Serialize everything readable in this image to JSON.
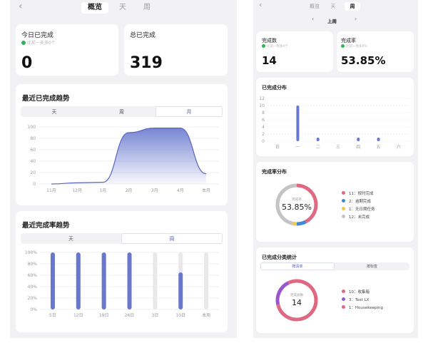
{
  "colors": {
    "accent": "#6878cf",
    "light_bar": "#e9e9ec",
    "pink": "#dd6a82",
    "blue": "#3f8bd6",
    "yellow": "#f2c94c",
    "gray": "#c4c4c4",
    "purple": "#9a56d1",
    "green": "#2fb45a"
  },
  "left": {
    "tabs": [
      "概览",
      "天",
      "周"
    ],
    "today": {
      "label": "今日已完成",
      "sub": "比前一天多0个",
      "value": "0"
    },
    "total": {
      "label": "总已完成",
      "value": "319"
    },
    "trend": {
      "title": "最近已完成趋势",
      "toggle": [
        "天",
        "周",
        "月"
      ]
    },
    "rate": {
      "title": "最近完成率趋势",
      "toggle": [
        "天",
        "周"
      ]
    }
  },
  "right": {
    "tabs": [
      "概览",
      "天",
      "周"
    ],
    "period": "上周",
    "done": {
      "label": "完成数",
      "sub": "比前一周多0个",
      "value": "14"
    },
    "rate": {
      "label": "完成率",
      "sub": "比前一周多0%",
      "value": "53.85%"
    },
    "dist": {
      "title": "已完成分布"
    },
    "rate_dist": {
      "title": "完成率分布",
      "center_label": "完成率",
      "center_value": "53.85%",
      "legend": [
        "11：按时完成",
        "2：逾期完成",
        "1：无日期任务",
        "12：未完成"
      ]
    },
    "cat": {
      "title": "已完成分类统计",
      "toggle": [
        "按清单",
        "按标签"
      ],
      "center_label": "完成总数",
      "center_value": "14",
      "legend": [
        "10：收集箱",
        "3：Test LX",
        "1：Housekeeping"
      ]
    }
  },
  "chart_data": [
    {
      "type": "area",
      "categories": [
        "11月",
        "12月",
        "1月",
        "2月",
        "3月",
        "4月",
        "本月"
      ],
      "values": [
        0,
        2,
        3,
        90,
        98,
        98,
        18
      ],
      "yticks": [
        "100",
        "80",
        "60",
        "40",
        "20",
        "0"
      ],
      "ylim": [
        0,
        100
      ]
    },
    {
      "type": "bar",
      "categories": [
        "5日",
        "12日",
        "19日",
        "26日",
        "3日",
        "10日",
        "本周"
      ],
      "values": [
        100,
        100,
        100,
        100,
        0,
        65,
        0
      ],
      "yticks": [
        "100%",
        "80%",
        "60%",
        "40%",
        "20%",
        "0%"
      ],
      "ylim": [
        0,
        100
      ]
    },
    {
      "type": "bar",
      "categories": [
        "日",
        "一",
        "二",
        "三",
        "四",
        "五",
        "六"
      ],
      "values": [
        0,
        10,
        1,
        0,
        1,
        1,
        0
      ],
      "yticks": [
        "12",
        "10",
        "8",
        "6",
        "4",
        "2",
        "0"
      ],
      "ylim": [
        0,
        12
      ]
    },
    {
      "type": "pie",
      "labels": [
        "按时完成",
        "逾期完成",
        "无日期任务",
        "未完成"
      ],
      "values": [
        11,
        2,
        1,
        12
      ]
    },
    {
      "type": "pie",
      "labels": [
        "收集箱",
        "Test LX",
        "Housekeeping"
      ],
      "values": [
        10,
        3,
        1
      ]
    }
  ]
}
